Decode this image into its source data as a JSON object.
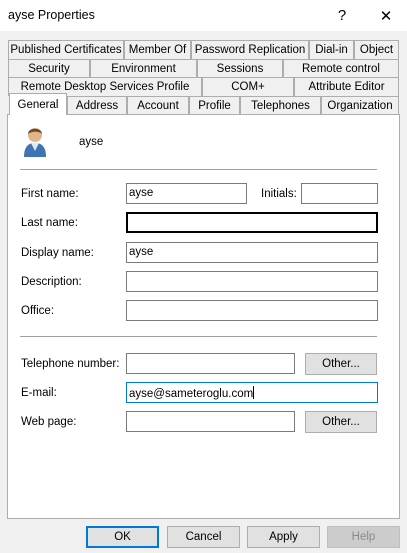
{
  "window": {
    "title": "ayse Properties",
    "help_glyph": "?",
    "close_glyph": "✕"
  },
  "tabs": {
    "row1": [
      "Published Certificates",
      "Member Of",
      "Password Replication",
      "Dial-in",
      "Object"
    ],
    "row2": [
      "Security",
      "Environment",
      "Sessions",
      "Remote control"
    ],
    "row3": [
      "Remote Desktop Services Profile",
      "COM+",
      "Attribute Editor"
    ],
    "row4": [
      "General",
      "Address",
      "Account",
      "Profile",
      "Telephones",
      "Organization"
    ],
    "active": "General"
  },
  "general": {
    "user_name": "ayse",
    "first_name_label": "First name:",
    "first_name_value": "ayse",
    "initials_label": "Initials:",
    "initials_value": "",
    "last_name_label": "Last name:",
    "last_name_value": "",
    "display_name_label": "Display name:",
    "display_name_value": "ayse",
    "description_label": "Description:",
    "description_value": "",
    "office_label": "Office:",
    "office_value": "",
    "telephone_label": "Telephone number:",
    "telephone_value": "",
    "telephone_other": "Other...",
    "email_label": "E-mail:",
    "email_value": "ayse@sameteroglu.com",
    "webpage_label": "Web page:",
    "webpage_value": "",
    "webpage_other": "Other..."
  },
  "footer": {
    "ok": "OK",
    "cancel": "Cancel",
    "apply": "Apply",
    "help": "Help"
  }
}
